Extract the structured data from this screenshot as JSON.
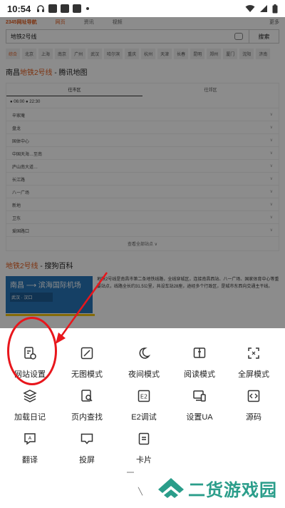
{
  "status_bar": {
    "time": "10:54"
  },
  "browser_page": {
    "nav": {
      "logo": "2345网址导航",
      "active_tab": "网页",
      "tab2": "资讯",
      "tab3": "视频",
      "more": "更多"
    },
    "search": {
      "query": "地铁2号线",
      "button_label": "搜索"
    },
    "chips": [
      "综合",
      "北京",
      "上海",
      "南京",
      "广州",
      "武汉",
      "哈尔滨",
      "重庆",
      "杭州",
      "天津",
      "长春",
      "昆明",
      "郑州",
      "厦门",
      "沈阳",
      "济南"
    ],
    "result1": {
      "prefix": "南昌",
      "highlight": "地铁2号线",
      "suffix": " - 腾讯地图"
    },
    "tabs": [
      "往市区",
      "往郊区"
    ],
    "times": "● 06:00   ● 22:30",
    "rows": [
      "辛家庵",
      "盘龙",
      "国体中心",
      "中国天海…至南",
      "庐山南大道…",
      "长江路",
      "八一广场",
      "新地",
      "卫东",
      "爱国路口"
    ],
    "more_line": "查看全部站点 ∨",
    "result2": {
      "highlight": "地铁2号线",
      "suffix": " - 搜狗百科"
    },
    "thumb": {
      "line": "南昌 ⟶ 滨海国际机场",
      "sub": "武汉 · 汉口"
    },
    "desc": "地铁2号线是南昌市第二条地铁线路，全线穿城区，连接南昌西站、八一广场、国家体育中心等重要站点，线路全长约31.5公里，共设车站28座，途经多个行政区，是城市东西向交通主干线。"
  },
  "menu": {
    "items": [
      {
        "id": "site-settings",
        "label": "网站设置",
        "icon": "document-gear-icon"
      },
      {
        "id": "no-image",
        "label": "无图模式",
        "icon": "no-image-icon"
      },
      {
        "id": "night-mode",
        "label": "夜间模式",
        "icon": "moon-icon"
      },
      {
        "id": "reading-mode",
        "label": "阅读模式",
        "icon": "book-icon"
      },
      {
        "id": "fullscreen",
        "label": "全屏模式",
        "icon": "fullscreen-icon"
      },
      {
        "id": "load-log",
        "label": "加载日记",
        "icon": "layers-icon"
      },
      {
        "id": "find-in-page",
        "label": "页内查找",
        "icon": "find-in-page-icon"
      },
      {
        "id": "e2-debug",
        "label": "E2调试",
        "icon": "e2-icon"
      },
      {
        "id": "set-ua",
        "label": "设置UA",
        "icon": "device-icon"
      },
      {
        "id": "source",
        "label": "源码",
        "icon": "code-icon"
      },
      {
        "id": "translate",
        "label": "翻译",
        "icon": "translate-icon"
      },
      {
        "id": "cast",
        "label": "投屏",
        "icon": "cast-icon"
      },
      {
        "id": "card",
        "label": "卡片",
        "icon": "card-icon"
      }
    ]
  },
  "watermark": {
    "text": "二货游戏园"
  },
  "colors": {
    "accent": "#e25b1c",
    "highlight_circle": "#e8161c",
    "watermark": "#2a9d8a"
  }
}
